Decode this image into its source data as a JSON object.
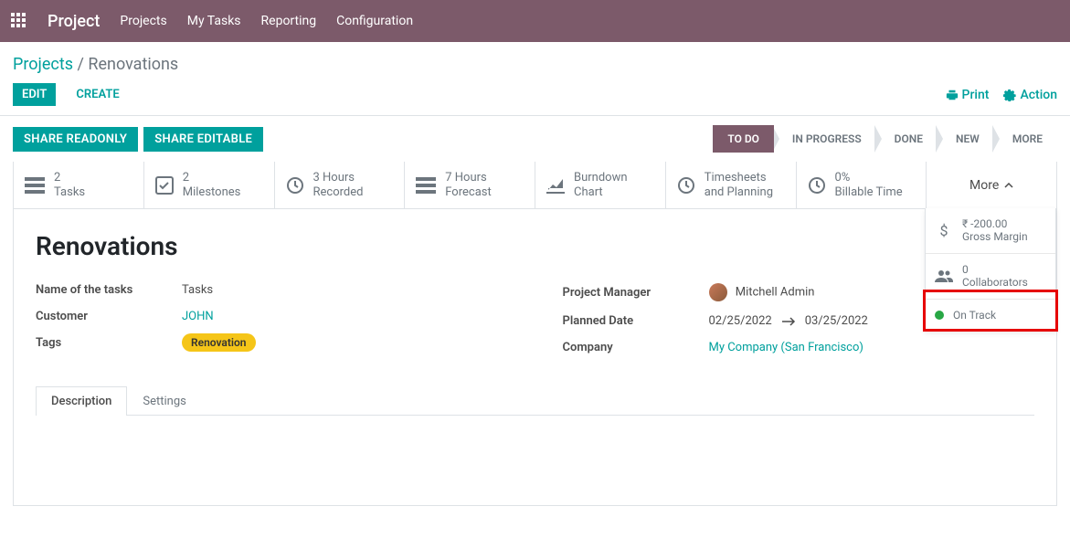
{
  "topbar": {
    "brand": "Project",
    "nav": [
      "Projects",
      "My Tasks",
      "Reporting",
      "Configuration"
    ]
  },
  "breadcrumb": {
    "parent": "Projects",
    "current": "Renovations"
  },
  "actions": {
    "edit": "EDIT",
    "create": "CREATE",
    "print": "Print",
    "action": "Action"
  },
  "share": {
    "readonly": "SHARE READONLY",
    "editable": "SHARE EDITABLE"
  },
  "stages": [
    "TO DO",
    "IN PROGRESS",
    "DONE",
    "NEW",
    "MORE"
  ],
  "active_stage": 0,
  "stats": [
    {
      "value": "2",
      "label": "Tasks",
      "icon": "tasks"
    },
    {
      "value": "2",
      "label": "Milestones",
      "icon": "check"
    },
    {
      "value": "3 Hours",
      "label": "Recorded",
      "icon": "clock"
    },
    {
      "value": "7 Hours",
      "label": "Forecast",
      "icon": "tasks"
    },
    {
      "value": "Burndown",
      "label": "Chart",
      "icon": "chart"
    },
    {
      "value": "Timesheets",
      "label": "and Planning",
      "icon": "clock"
    },
    {
      "value": "0%",
      "label": "Billable Time",
      "icon": "clock"
    }
  ],
  "more_toggle": "More",
  "title": "Renovations",
  "fields": {
    "left": [
      {
        "label": "Name of the tasks",
        "value": "Tasks",
        "type": "text"
      },
      {
        "label": "Customer",
        "value": "JOHN",
        "type": "link"
      },
      {
        "label": "Tags",
        "value": "Renovation",
        "type": "tag"
      }
    ],
    "right": [
      {
        "label": "Project Manager",
        "value": "Mitchell Admin",
        "type": "user"
      },
      {
        "label": "Planned Date",
        "start": "02/25/2022",
        "end": "03/25/2022",
        "type": "daterange"
      },
      {
        "label": "Company",
        "value": "My Company (San Francisco)",
        "type": "link"
      }
    ]
  },
  "tabs": [
    "Description",
    "Settings"
  ],
  "active_tab": 0,
  "float_panel": [
    {
      "value": "₹ -200.00",
      "label": "Gross Margin",
      "icon": "money"
    },
    {
      "value": "0",
      "label": "Collaborators",
      "icon": "users"
    },
    {
      "value": "On Track",
      "label": "",
      "icon": "status"
    }
  ]
}
